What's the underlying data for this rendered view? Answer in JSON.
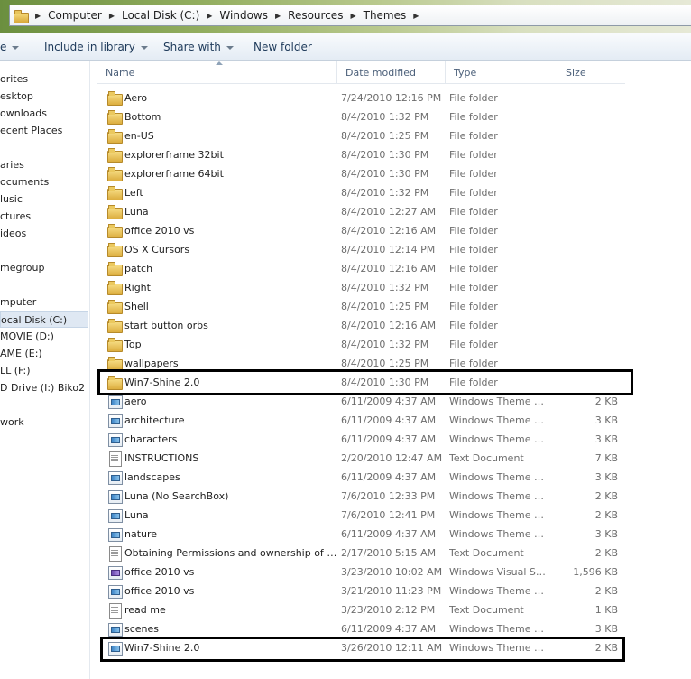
{
  "breadcrumb": [
    "Computer",
    "Local Disk (C:)",
    "Windows",
    "Resources",
    "Themes"
  ],
  "toolbar": {
    "organize_label": "e",
    "include_label": "Include in library",
    "share_label": "Share with",
    "newfolder_label": "New folder"
  },
  "nav": {
    "items": [
      {
        "label": "orites"
      },
      {
        "label": "esktop"
      },
      {
        "label": "ownloads"
      },
      {
        "label": "ecent Places"
      },
      {
        "label": "aries"
      },
      {
        "label": "ocuments"
      },
      {
        "label": "lusic"
      },
      {
        "label": "ctures"
      },
      {
        "label": "ideos"
      },
      {
        "label": "megroup"
      },
      {
        "label": "mputer"
      },
      {
        "label": "ocal Disk (C:)"
      },
      {
        "label": "MOVIE (D:)"
      },
      {
        "label": "AME (E:)"
      },
      {
        "label": "LL (F:)"
      },
      {
        "label": "D Drive (I:) Biko2"
      },
      {
        "label": "work"
      }
    ]
  },
  "columns": {
    "name": "Name",
    "date": "Date modified",
    "type": "Type",
    "size": "Size"
  },
  "files": [
    {
      "name": "Aero",
      "date": "7/24/2010 12:16 PM",
      "type": "File folder",
      "size": "",
      "icon": "folder-icon"
    },
    {
      "name": "Bottom",
      "date": "8/4/2010 1:32 PM",
      "type": "File folder",
      "size": "",
      "icon": "folder-icon"
    },
    {
      "name": "en-US",
      "date": "8/4/2010 1:25 PM",
      "type": "File folder",
      "size": "",
      "icon": "folder-icon"
    },
    {
      "name": "explorerframe 32bit",
      "date": "8/4/2010 1:30 PM",
      "type": "File folder",
      "size": "",
      "icon": "folder-icon"
    },
    {
      "name": "explorerframe 64bit",
      "date": "8/4/2010 1:30 PM",
      "type": "File folder",
      "size": "",
      "icon": "folder-icon"
    },
    {
      "name": "Left",
      "date": "8/4/2010 1:32 PM",
      "type": "File folder",
      "size": "",
      "icon": "folder-icon"
    },
    {
      "name": "Luna",
      "date": "8/4/2010 12:27 AM",
      "type": "File folder",
      "size": "",
      "icon": "folder-icon"
    },
    {
      "name": "office 2010 vs",
      "date": "8/4/2010 12:16 AM",
      "type": "File folder",
      "size": "",
      "icon": "folder-icon"
    },
    {
      "name": "OS X  Cursors",
      "date": "8/4/2010 12:14 PM",
      "type": "File folder",
      "size": "",
      "icon": "folder-icon"
    },
    {
      "name": "patch",
      "date": "8/4/2010 12:16 AM",
      "type": "File folder",
      "size": "",
      "icon": "folder-icon"
    },
    {
      "name": "Right",
      "date": "8/4/2010 1:32 PM",
      "type": "File folder",
      "size": "",
      "icon": "folder-icon"
    },
    {
      "name": "Shell",
      "date": "8/4/2010 1:25 PM",
      "type": "File folder",
      "size": "",
      "icon": "folder-icon"
    },
    {
      "name": "start button orbs",
      "date": "8/4/2010 12:16 AM",
      "type": "File folder",
      "size": "",
      "icon": "folder-icon"
    },
    {
      "name": "Top",
      "date": "8/4/2010 1:32 PM",
      "type": "File folder",
      "size": "",
      "icon": "folder-icon"
    },
    {
      "name": "wallpapers",
      "date": "8/4/2010 1:25 PM",
      "type": "File folder",
      "size": "",
      "icon": "folder-icon"
    },
    {
      "name": "Win7-Shine 2.0",
      "date": "8/4/2010 1:30 PM",
      "type": "File folder",
      "size": "",
      "icon": "folder-icon"
    },
    {
      "name": "aero",
      "date": "6/11/2009 4:37 AM",
      "type": "Windows Theme File",
      "size": "2 KB",
      "icon": "theme-file-icon"
    },
    {
      "name": "architecture",
      "date": "6/11/2009 4:37 AM",
      "type": "Windows Theme File",
      "size": "3 KB",
      "icon": "theme-file-icon"
    },
    {
      "name": "characters",
      "date": "6/11/2009 4:37 AM",
      "type": "Windows Theme File",
      "size": "3 KB",
      "icon": "theme-file-icon"
    },
    {
      "name": "INSTRUCTIONS",
      "date": "2/20/2010 12:47 AM",
      "type": "Text Document",
      "size": "7 KB",
      "icon": "text-document-icon"
    },
    {
      "name": "landscapes",
      "date": "6/11/2009 4:37 AM",
      "type": "Windows Theme File",
      "size": "3 KB",
      "icon": "theme-file-icon"
    },
    {
      "name": "Luna (No SearchBox)",
      "date": "7/6/2010 12:33 PM",
      "type": "Windows Theme File",
      "size": "2 KB",
      "icon": "theme-file-icon"
    },
    {
      "name": "Luna",
      "date": "7/6/2010 12:41 PM",
      "type": "Windows Theme File",
      "size": "2 KB",
      "icon": "theme-file-icon"
    },
    {
      "name": "nature",
      "date": "6/11/2009 4:37 AM",
      "type": "Windows Theme File",
      "size": "3 KB",
      "icon": "theme-file-icon"
    },
    {
      "name": "Obtaining Permissions and ownership of s...",
      "date": "2/17/2010 5:15 AM",
      "type": "Text Document",
      "size": "2 KB",
      "icon": "text-document-icon"
    },
    {
      "name": "office 2010 vs",
      "date": "3/23/2010 10:02 AM",
      "type": "Windows Visual St...",
      "size": "1,596 KB",
      "icon": "visual-style-file-icon"
    },
    {
      "name": "office 2010 vs",
      "date": "3/21/2010 11:23 PM",
      "type": "Windows Theme File",
      "size": "2 KB",
      "icon": "theme-file-icon"
    },
    {
      "name": "read me",
      "date": "3/23/2010 2:12 PM",
      "type": "Text Document",
      "size": "1 KB",
      "icon": "text-document-icon"
    },
    {
      "name": "scenes",
      "date": "6/11/2009 4:37 AM",
      "type": "Windows Theme File",
      "size": "3 KB",
      "icon": "theme-file-icon"
    },
    {
      "name": "Win7-Shine 2.0",
      "date": "3/26/2010 12:11 AM",
      "type": "Windows Theme File",
      "size": "2 KB",
      "icon": "theme-file-icon"
    }
  ],
  "colors": {
    "highlight_border": "#000000",
    "link_text": "#1e3a5a"
  }
}
